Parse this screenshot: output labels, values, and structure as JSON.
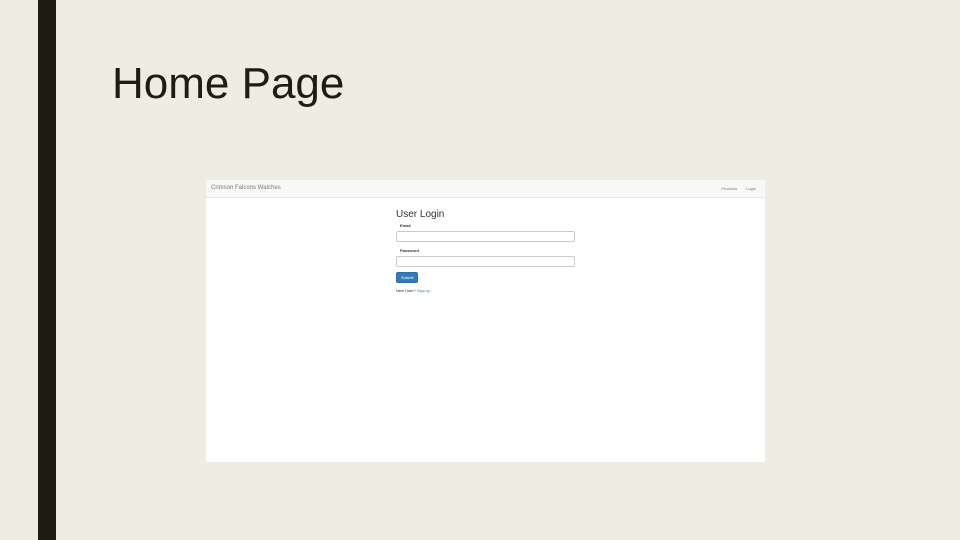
{
  "slide": {
    "title": "Home Page"
  },
  "app": {
    "brand": "Crimson Falcons Watches",
    "nav": {
      "products_label": "Products",
      "login_label": "Login"
    },
    "login": {
      "heading": "User Login",
      "email_label": "Email",
      "email_value": "",
      "password_label": "Password",
      "password_value": "",
      "submit_label": "Submit",
      "new_user_text": "New User?",
      "signup_label": "Sign up"
    }
  },
  "colors": {
    "slide_background": "#efece4",
    "accent_bar": "#1d1d14",
    "navbar_background": "#f8f8f8",
    "primary_button": "#337ab7",
    "link": "#337ab7"
  }
}
